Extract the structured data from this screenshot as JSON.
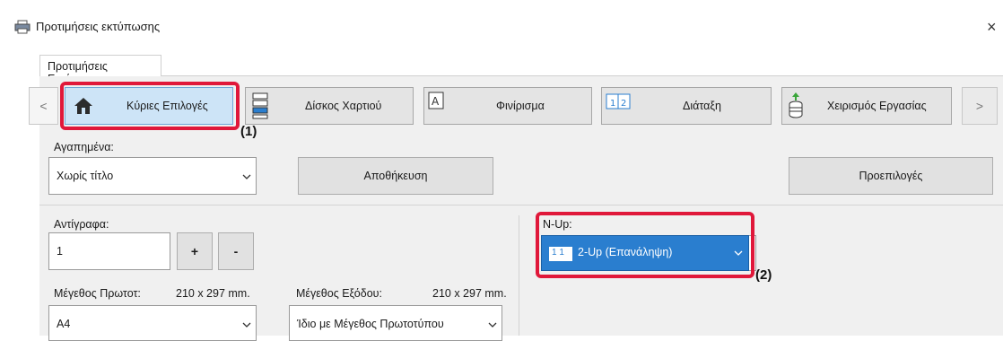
{
  "window": {
    "title": "Προτιμήσεις εκτύπωσης",
    "close_glyph": "×"
  },
  "tabs": [
    {
      "label": "Προτιμήσεις Εκτύπωσης"
    }
  ],
  "toolbar": {
    "prev_glyph": "<",
    "next_glyph": ">",
    "items": [
      {
        "label": "Κύριες Επιλογές",
        "icon": "home-icon",
        "active": true
      },
      {
        "label": "Δίσκος Χαρτιού",
        "icon": "paper-tray-icon"
      },
      {
        "label": "Φινίρισμα",
        "icon": "finishing-icon"
      },
      {
        "label": "Διάταξη",
        "icon": "layout-icon"
      },
      {
        "label": "Χειρισμός Εργασίας",
        "icon": "job-handling-icon"
      }
    ]
  },
  "favorites": {
    "label": "Αγαπημένα:",
    "value": "Χωρίς τίτλο",
    "save_label": "Αποθήκευση",
    "defaults_label": "Προεπιλογές"
  },
  "copies": {
    "label": "Αντίγραφα:",
    "value": "1",
    "plus": "+",
    "minus": "-"
  },
  "original_size": {
    "label": "Μέγεθος Πρωτοτ:",
    "dims": "210 x 297 mm.",
    "value": "A4"
  },
  "output_size": {
    "label": "Μέγεθος Εξόδου:",
    "dims": "210 x 297 mm.",
    "value": "Ίδιο με Μέγεθος Πρωτοτύπου"
  },
  "nup": {
    "label": "N-Up:",
    "value": "2-Up (Επανάληψη)",
    "icon_text": "1 1"
  },
  "callouts": {
    "one": "(1)",
    "two": "(2)"
  },
  "colors": {
    "accent": "#2a7ecf",
    "highlight": "#e0183a",
    "active_tab": "#cde4f7"
  }
}
